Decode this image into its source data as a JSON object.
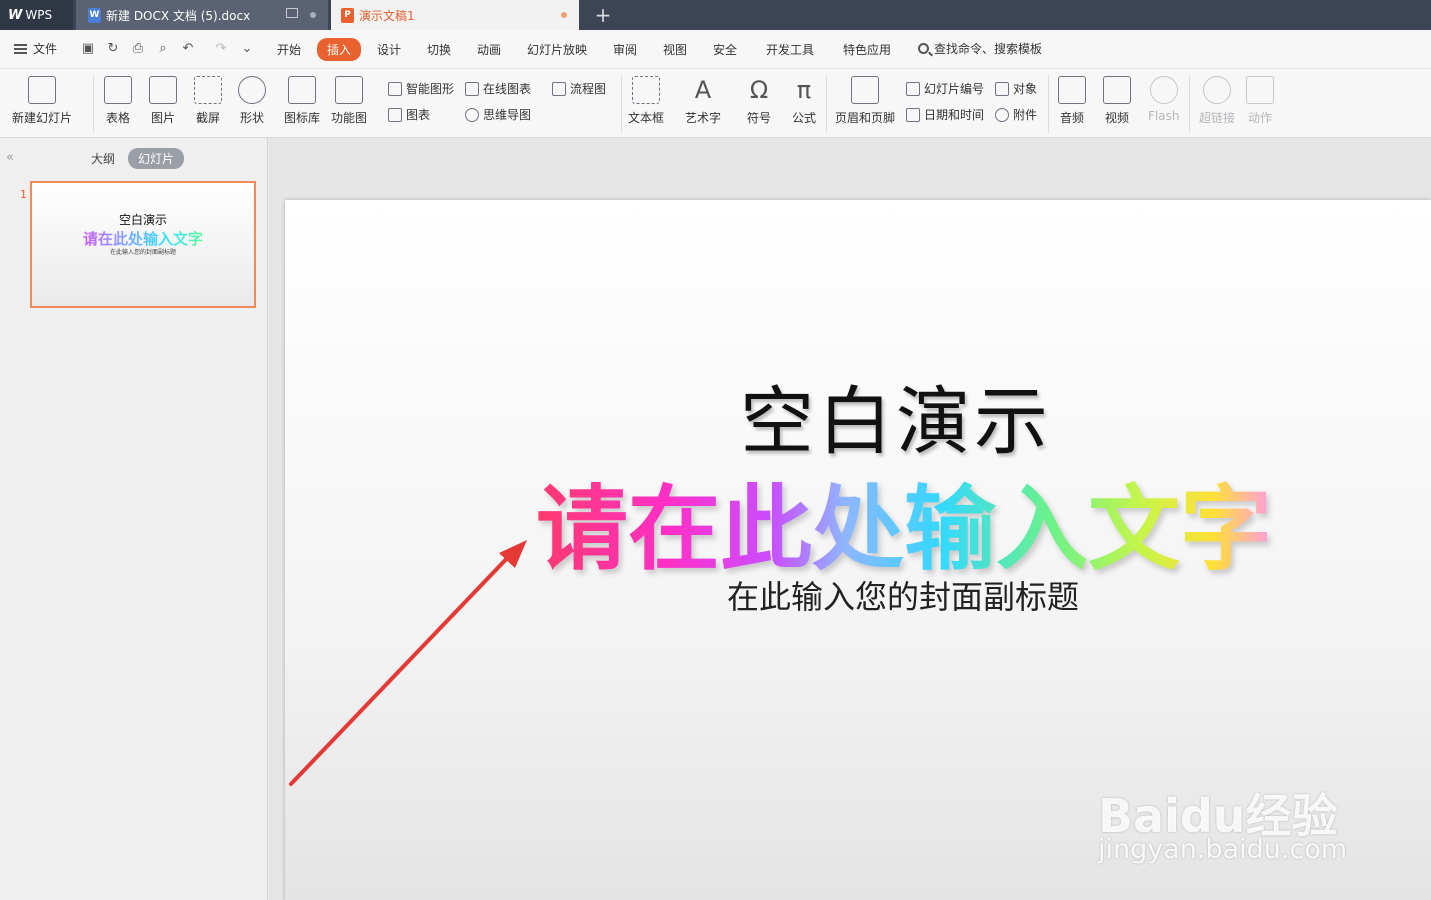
{
  "titlebar": {
    "tabs": [
      {
        "label": "WPS"
      },
      {
        "label": "新建 DOCX 文档 (5).docx"
      },
      {
        "label": "演示文稿1"
      }
    ],
    "new_tab": "+"
  },
  "menubar": {
    "file": "文件",
    "items": [
      "开始",
      "插入",
      "设计",
      "切换",
      "动画",
      "幻灯片放映",
      "审阅",
      "视图",
      "安全",
      "开发工具",
      "特色应用"
    ],
    "active": "插入",
    "search": "查找命令、搜索模板"
  },
  "ribbon": {
    "new_slide": "新建幻灯片",
    "table": "表格",
    "picture": "图片",
    "screenshot": "截屏",
    "shape": "形状",
    "icon_lib": "图标库",
    "func_chart": "功能图",
    "smart_shape": "智能图形",
    "online_chart": "在线图表",
    "flowchart": "流程图",
    "chart": "图表",
    "mindmap": "思维导图",
    "textbox": "文本框",
    "wordart": "艺术字",
    "symbol": "符号",
    "formula": "公式",
    "header_footer": "页眉和页脚",
    "slide_number": "幻灯片编号",
    "object": "对象",
    "datetime": "日期和时间",
    "attachment": "附件",
    "audio": "音频",
    "video": "视频",
    "flash": "Flash",
    "hyperlink": "超链接",
    "action": "动作"
  },
  "leftpanel": {
    "outline_tab": "大纲",
    "slides_tab": "幻灯片",
    "slide_number": "1",
    "thumb": {
      "title": "空白演示",
      "art": "请在此处输入文字",
      "subtitle": "在此输入您的封面副标题"
    }
  },
  "slide": {
    "title": "空白演示",
    "art_text": "请在此处输入文字",
    "subtitle": "在此输入您的封面副标题"
  },
  "watermark": {
    "brand": "Baidu经验",
    "url": "jingyan.baidu.com"
  },
  "colors": {
    "accent": "#e8612e",
    "titlebar": "#3d4453",
    "arrow": "#e53935"
  }
}
